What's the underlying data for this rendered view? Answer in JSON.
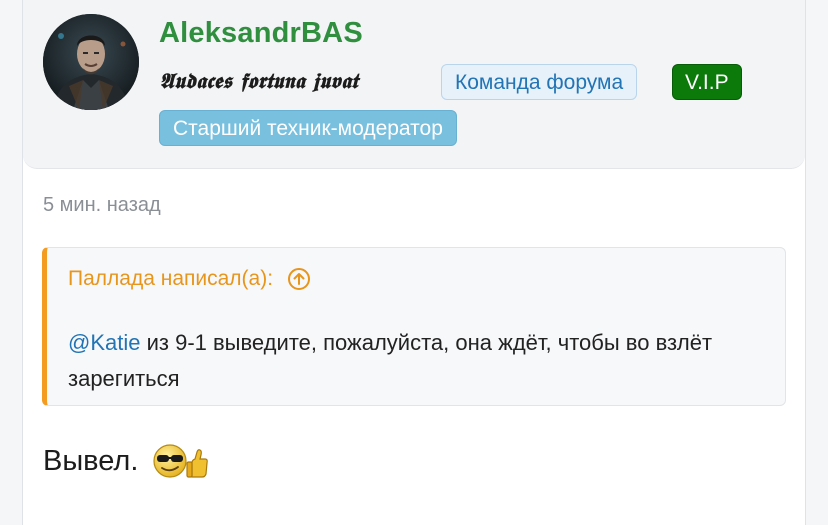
{
  "post": {
    "author": {
      "username": "AleksandrBAS",
      "motto": "𝕬𝖚𝖉𝖆𝖈𝖊𝖘 𝖋𝖔𝖗𝖙𝖚𝖓𝖆 𝖏𝖚𝖛𝖆𝖙",
      "avatar_icon": "avatar-portrait",
      "badges": [
        {
          "label": "Команда форума",
          "color": "#2274b5"
        },
        {
          "label": "V.I.P",
          "color": "#0b7a0b"
        },
        {
          "label": "Старший техник-модератор",
          "color": "#79c0df"
        }
      ]
    },
    "timestamp": "5 мин. назад",
    "quote": {
      "header": "Паллада написал(а):",
      "header_icon": "arrow-up-circle-icon",
      "mention": "@Katie",
      "text": " из 9-1 выведите, пожалуйста, она ждёт, чтобы во взлёт зарегиться"
    },
    "message": {
      "text": "Вывел.",
      "emoji_icon": "cool-thumbs-up-smiley-icon"
    }
  },
  "colors": {
    "username": "#2f8f3f",
    "quote_accent": "#f39c1f",
    "link": "#2274b5"
  }
}
